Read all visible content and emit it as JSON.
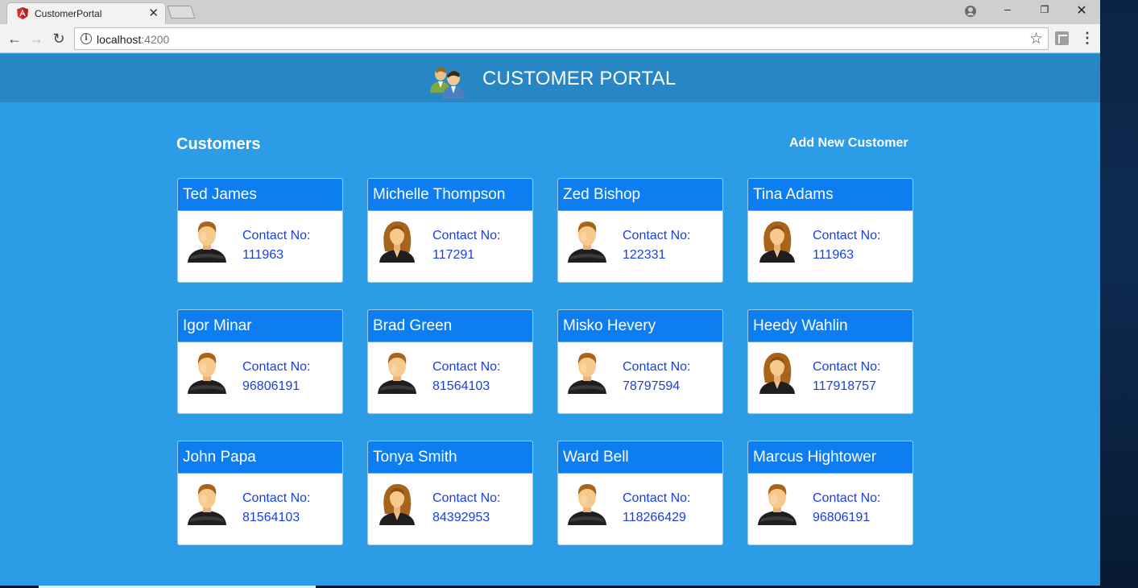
{
  "browser": {
    "tab_title": "CustomerPortal",
    "url_host": "localhost",
    "url_port": ":4200"
  },
  "header": {
    "title": "CUSTOMER PORTAL"
  },
  "main": {
    "section_title": "Customers",
    "add_link": "Add New Customer",
    "contact_label": "Contact No:",
    "customers": [
      {
        "name": "Ted James",
        "contact": "111963",
        "gender": "male"
      },
      {
        "name": "Michelle Thompson",
        "contact": "117291",
        "gender": "female"
      },
      {
        "name": "Zed Bishop",
        "contact": "122331",
        "gender": "male"
      },
      {
        "name": "Tina Adams",
        "contact": "111963",
        "gender": "female"
      },
      {
        "name": "Igor Minar",
        "contact": "96806191",
        "gender": "male"
      },
      {
        "name": "Brad Green",
        "contact": "81564103",
        "gender": "male"
      },
      {
        "name": "Misko Hevery",
        "contact": "78797594",
        "gender": "male"
      },
      {
        "name": "Heedy Wahlin",
        "contact": "117918757",
        "gender": "female"
      },
      {
        "name": "John Papa",
        "contact": "81564103",
        "gender": "male"
      },
      {
        "name": "Tonya Smith",
        "contact": "84392953",
        "gender": "female"
      },
      {
        "name": "Ward Bell",
        "contact": "118266429",
        "gender": "male"
      },
      {
        "name": "Marcus Hightower",
        "contact": "96806191",
        "gender": "male"
      }
    ]
  },
  "colors": {
    "page_bg": "#2d9ce6",
    "header_bg": "#2686c6",
    "card_header": "#0c7ef2",
    "contact_text": "#1a3fe0"
  }
}
